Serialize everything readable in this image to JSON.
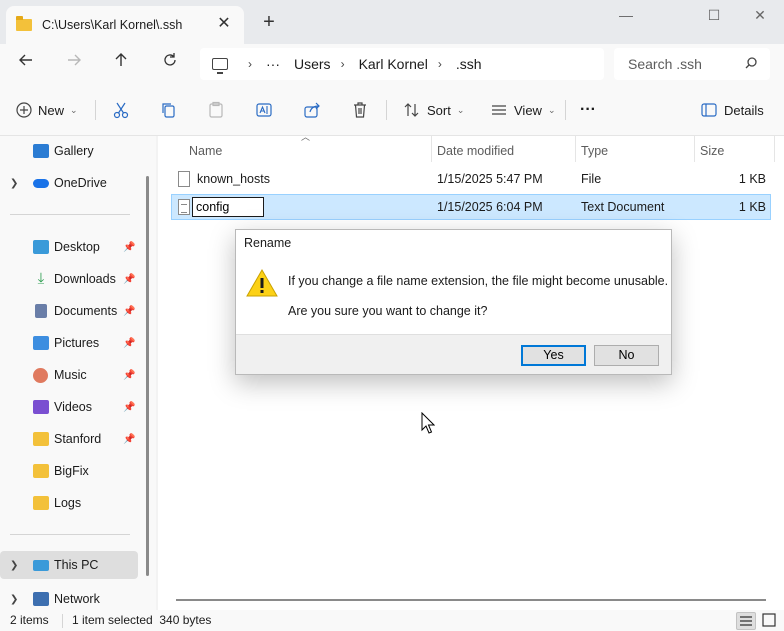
{
  "window": {
    "tab_title": "C:\\Users\\Karl Kornel\\.ssh",
    "close_tab_glyph": "✕",
    "new_tab_glyph": "+",
    "min_glyph": "—",
    "max_glyph": "☐",
    "close_glyph": "✕"
  },
  "address": {
    "overflow": "···",
    "crumbs": [
      "Users",
      "Karl Kornel",
      ".ssh"
    ],
    "search_placeholder": "Search .ssh"
  },
  "toolbar": {
    "new_label": "New",
    "sort_label": "Sort",
    "view_label": "View",
    "more_label": "···",
    "details_label": "Details"
  },
  "sidebar": {
    "items": [
      {
        "label": "Gallery",
        "color": "#2b7cd3"
      },
      {
        "label": "OneDrive",
        "color": "#1a73e8"
      },
      {
        "label": "Desktop",
        "color": "#3a9ad9"
      },
      {
        "label": "Downloads",
        "color": "#2e9e52"
      },
      {
        "label": "Documents",
        "color": "#6a7ea8"
      },
      {
        "label": "Pictures",
        "color": "#3d8ee0"
      },
      {
        "label": "Music",
        "color": "#e07a5f"
      },
      {
        "label": "Videos",
        "color": "#7a4fd1"
      },
      {
        "label": "Stanford",
        "color": "#f3c13a"
      },
      {
        "label": "BigFix",
        "color": "#f3c13a"
      },
      {
        "label": "Logs",
        "color": "#f3c13a"
      },
      {
        "label": "This PC",
        "color": "#3a9ad9"
      },
      {
        "label": "Network",
        "color": "#3d6fb0"
      }
    ]
  },
  "columns": {
    "name": "Name",
    "date": "Date modified",
    "type": "Type",
    "size": "Size"
  },
  "files": [
    {
      "name": "known_hosts",
      "date": "1/15/2025 5:47 PM",
      "type": "File",
      "size": "1 KB"
    },
    {
      "name": "config",
      "date": "1/15/2025 6:04 PM",
      "type": "Text Document",
      "size": "1 KB"
    }
  ],
  "dialog": {
    "title": "Rename",
    "message1": "If you change a file name extension, the file might become unusable.",
    "message2": "Are you sure you want to change it?",
    "yes_label": "Yes",
    "no_label": "No"
  },
  "status": {
    "items_count": "2 items",
    "selection": "1 item selected  340 bytes"
  }
}
